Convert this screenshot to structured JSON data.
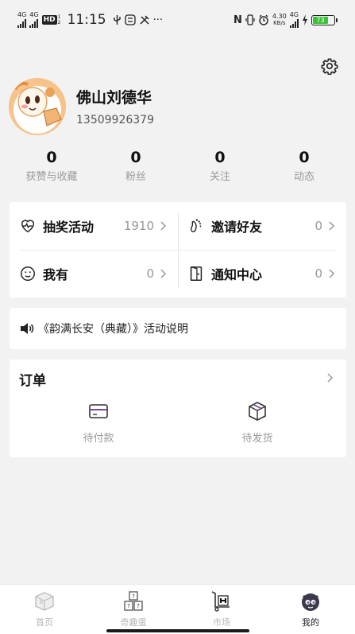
{
  "status_bar": {
    "time": "11:15",
    "net1": "4G",
    "net2": "4G",
    "hd": "HD",
    "hd_sub": "1 2",
    "more": "···",
    "nfc": "N",
    "speed_value": "4.30",
    "speed_unit": "KB/s",
    "net3": "4G",
    "battery_level": "73",
    "icons": [
      "signal-icon",
      "signal-icon",
      "hd-icon",
      "usb-icon",
      "app-icon",
      "tools-icon",
      "nfc-icon",
      "vibrate-icon",
      "alarm-icon",
      "charging-icon",
      "battery-icon"
    ]
  },
  "profile": {
    "name": "佛山刘德华",
    "phone": "13509926379"
  },
  "stats": [
    {
      "value": "0",
      "label": "获赞与收藏"
    },
    {
      "value": "0",
      "label": "粉丝"
    },
    {
      "value": "0",
      "label": "关注"
    },
    {
      "value": "0",
      "label": "动态"
    }
  ],
  "menu": [
    {
      "label": "抽奖活动",
      "count": "1910",
      "icon": "heart-pulse-icon"
    },
    {
      "label": "邀请好友",
      "count": "0",
      "icon": "footprint-icon"
    },
    {
      "label": "我有",
      "count": "0",
      "icon": "smiley-icon"
    },
    {
      "label": "通知中心",
      "count": "0",
      "icon": "notice-door-icon"
    }
  ],
  "notice": {
    "text": "《韵满长安（典藏）》活动说明",
    "icon": "speaker-icon"
  },
  "orders": {
    "title": "订单",
    "items": [
      {
        "label": "待付款",
        "icon": "card-icon"
      },
      {
        "label": "待发货",
        "icon": "box-icon"
      }
    ]
  },
  "tabbar": {
    "items": [
      {
        "label": "首页",
        "icon": "home-cube-icon"
      },
      {
        "label": "奇趣蛋",
        "icon": "mystery-boxes-icon"
      },
      {
        "label": "市场",
        "icon": "cart-icon"
      },
      {
        "label": "我的",
        "icon": "mascot-icon"
      }
    ],
    "active_index": 3,
    "active_color": "#222222",
    "inactive_color": "#b5b5b5"
  },
  "colors": {
    "background": "#f2f2f2",
    "card": "#ffffff",
    "accent_purple": "#7a4a9a",
    "battery_green": "#3cc23a"
  }
}
